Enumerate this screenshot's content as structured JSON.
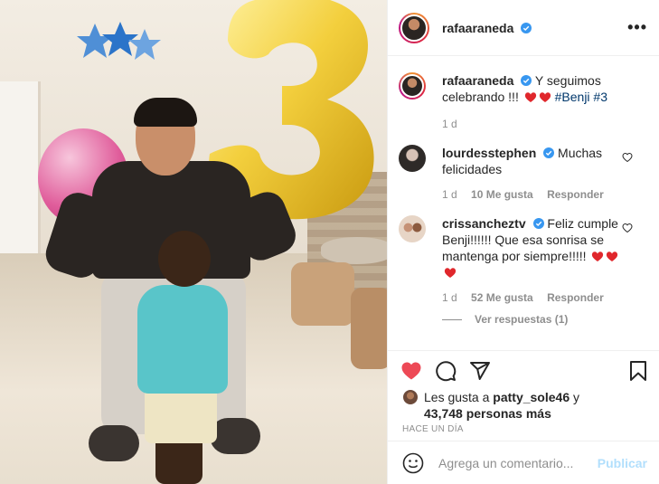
{
  "post": {
    "author": "rafaaraneda",
    "colors": {
      "like_red": "#ed4956",
      "link_blue": "#00376b",
      "publish_disabled": "#b2dffc",
      "muted": "#8e8e8e"
    }
  },
  "header": {
    "username": "rafaaraneda",
    "more_label": "•••"
  },
  "caption": {
    "username": "rafaaraneda",
    "text": "Y seguimos celebrando !!!",
    "tags": "#Benji #3",
    "time": "1 d"
  },
  "comments": [
    {
      "username": "lourdesstephen",
      "text": "Muchas felicidades",
      "time": "1 d",
      "likes": "10 Me gusta",
      "reply": "Responder"
    },
    {
      "username": "crissancheztv",
      "text": "Feliz cumple Benji!!!!!! Que esa sonrisa se mantenga por siempre!!!!!",
      "time": "1 d",
      "likes": "52 Me gusta",
      "reply": "Responder",
      "view_replies": "Ver respuestas (1)"
    }
  ],
  "likes": {
    "prefix": "Les gusta a",
    "user": "patty_sole46",
    "connector": "y",
    "count": "43,748 personas más"
  },
  "timeago": "HACE UN DÍA",
  "add_comment": {
    "placeholder": "Agrega un comentario...",
    "publish": "Publicar"
  }
}
